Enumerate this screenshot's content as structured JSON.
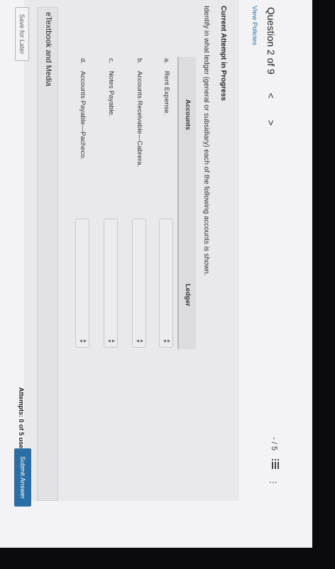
{
  "question": {
    "title": "Question 2 of 9",
    "prev_glyph": "<",
    "next_glyph": ">",
    "view_policies": "View Policies",
    "score": "- / 5",
    "list_icon": "list-icon",
    "more_icon": "more-icon"
  },
  "attempt": {
    "status": "Current Attempt in Progress",
    "instruction": "Identify in what ledger (general or subsidiary) each of the following accounts is shown."
  },
  "table": {
    "headers": [
      "Accounts",
      "Ledger"
    ],
    "rows": [
      {
        "letter": "a.",
        "account": "Rent Expense.",
        "ledger": ""
      },
      {
        "letter": "b.",
        "account": "Accounts Receivable—Cabrera.",
        "ledger": ""
      },
      {
        "letter": "c.",
        "account": "Notes Payable.",
        "ledger": ""
      },
      {
        "letter": "d.",
        "account": "Accounts Payable—Pacheco.",
        "ledger": ""
      }
    ]
  },
  "etextbook": {
    "label": "eTextbook and Media"
  },
  "footer": {
    "save_later": "Save for Later",
    "attempts": "Attempts: 0 of 5 used",
    "submit": "Submit Answer"
  },
  "colors": {
    "accent": "#2a6ea6",
    "link": "#2b6ea8",
    "page_bg": "#f3f3f5"
  }
}
